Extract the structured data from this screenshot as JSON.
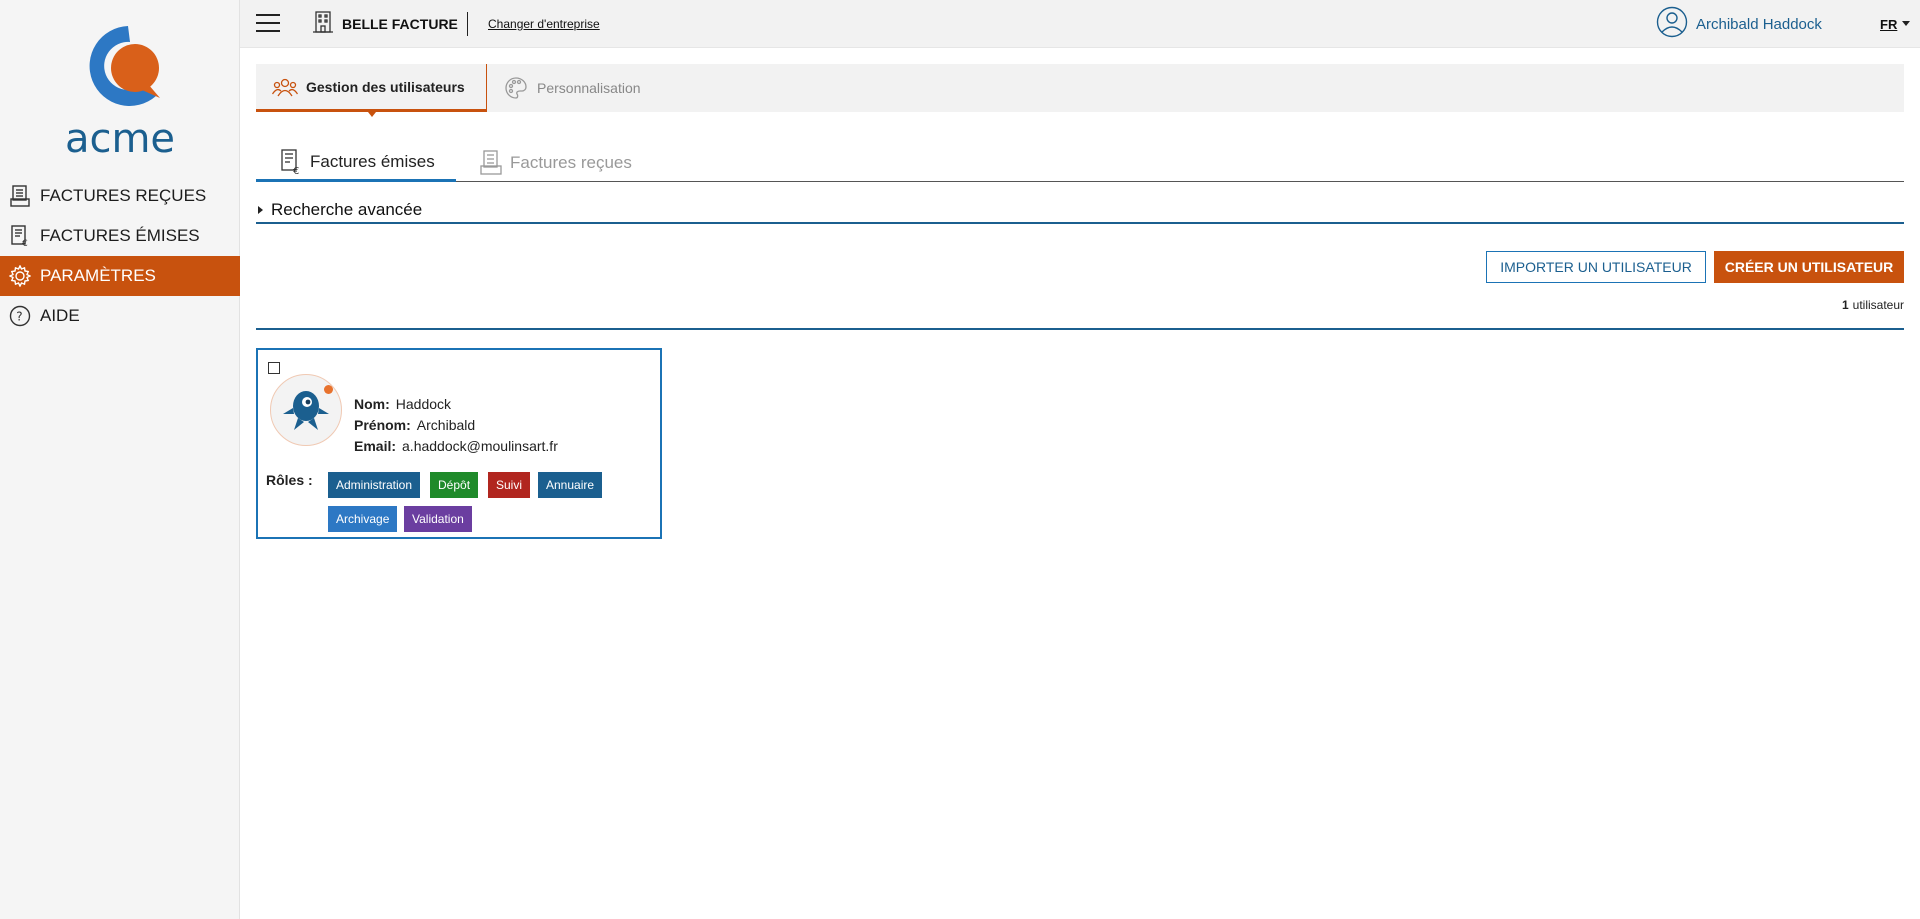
{
  "sidebar": {
    "logo_text": "acme",
    "items": [
      {
        "label": "FACTURES REÇUES",
        "icon": "received-invoices-icon"
      },
      {
        "label": "FACTURES ÉMISES",
        "icon": "issued-invoices-icon"
      },
      {
        "label": "PARAMÈTRES",
        "icon": "gear-icon",
        "active": true
      },
      {
        "label": "AIDE",
        "icon": "help-icon"
      }
    ]
  },
  "topbar": {
    "company_name": "BELLE FACTURE",
    "change_company": "Changer d'entreprise",
    "user_name": "Archibald Haddock",
    "lang": "FR"
  },
  "page_tabs": [
    {
      "label": "Gestion des utilisateurs",
      "icon": "users-icon",
      "active": true
    },
    {
      "label": "Personnalisation",
      "icon": "palette-icon",
      "active": false
    }
  ],
  "sub_tabs": [
    {
      "label": "Factures émises",
      "icon": "issued-invoices-icon",
      "active": true
    },
    {
      "label": "Factures reçues",
      "icon": "received-invoices-icon",
      "active": false
    }
  ],
  "advanced_search": "Recherche avancée",
  "actions": {
    "import_label": "IMPORTER UN UTILISATEUR",
    "create_label": "CRÉER UN UTILISATEUR"
  },
  "count": {
    "number": "1",
    "label": "utilisateur"
  },
  "user_card": {
    "fields": [
      {
        "label": "Nom:",
        "value": "Haddock"
      },
      {
        "label": "Prénom:",
        "value": "Archibald"
      },
      {
        "label": "Email:",
        "value": "a.haddock@moulinsart.fr"
      }
    ],
    "roles_label": "Rôles :",
    "roles": [
      {
        "label": "Administration",
        "color": "#1b5f8f"
      },
      {
        "label": "Dépôt",
        "color": "#1f8a2a"
      },
      {
        "label": "Suivi",
        "color": "#b1261f"
      },
      {
        "label": "Annuaire",
        "color": "#1b5f8f"
      },
      {
        "label": "Archivage",
        "color": "#2d78c4"
      },
      {
        "label": "Validation",
        "color": "#6b3ea0"
      }
    ]
  },
  "colors": {
    "accent": "#c8520e",
    "primary": "#1b5f8f"
  }
}
